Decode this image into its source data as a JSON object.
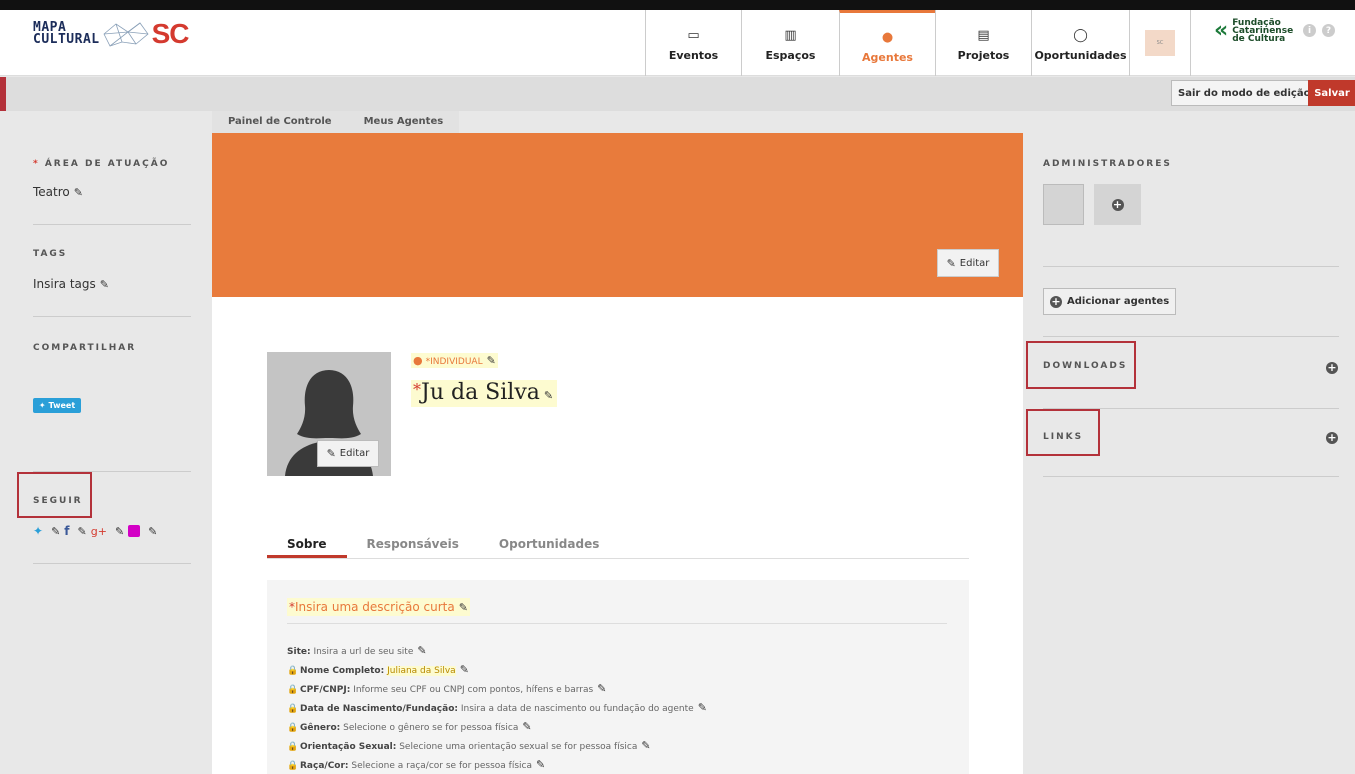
{
  "header": {
    "logo_text": "MAPA\nCULTURAL",
    "logo_sc": "SC",
    "nav": [
      {
        "label": "Eventos",
        "icon": "calendar-icon"
      },
      {
        "label": "Espaços",
        "icon": "building-icon"
      },
      {
        "label": "Agentes",
        "icon": "person-icon"
      },
      {
        "label": "Projetos",
        "icon": "document-icon"
      },
      {
        "label": "Oportunidades",
        "icon": "lightbulb-icon"
      }
    ],
    "partner_logo_text": "Fundação\nCatarinense\nde Cultura"
  },
  "editbar": {
    "exit_label": "Sair do modo de edição",
    "save_label": "Salvar"
  },
  "breadcrumb": [
    "Painel de Controle",
    "Meus Agentes"
  ],
  "left": {
    "area_title": "ÁREA DE ATUAÇÃO",
    "area_value": "Teatro",
    "tags_title": "TAGS",
    "tags_value": "Insira tags",
    "share_title": "COMPARTILHAR",
    "tweet_label": "Tweet",
    "follow_title": "SEGUIR"
  },
  "banner": {
    "edit_label": "Editar"
  },
  "profile": {
    "avatar_edit_label": "Editar",
    "type_label": "*INDIVIDUAL",
    "name": "Ju da Silva"
  },
  "tabs": [
    "Sobre",
    "Responsáveis",
    "Oportunidades"
  ],
  "about": {
    "short_desc": "Insira uma descrição curta",
    "fields": [
      {
        "label": "Site:",
        "value": "Insira a url de seu site",
        "locked": false,
        "filled": false
      },
      {
        "label": "Nome Completo:",
        "value": "Juliana da Silva",
        "locked": true,
        "filled": true
      },
      {
        "label": "CPF/CNPJ:",
        "value": "Informe seu CPF ou CNPJ com pontos, hífens e barras",
        "locked": true,
        "filled": false
      },
      {
        "label": "Data de Nascimento/Fundação:",
        "value": "Insira a data de nascimento ou fundação do agente",
        "locked": true,
        "filled": false
      },
      {
        "label": "Gênero:",
        "value": "Selecione o gênero se for pessoa física",
        "locked": true,
        "filled": false
      },
      {
        "label": "Orientação Sexual:",
        "value": "Selecione uma orientação sexual se for pessoa física",
        "locked": true,
        "filled": false
      },
      {
        "label": "Raça/Cor:",
        "value": "Selecione a raça/cor se for pessoa física",
        "locked": true,
        "filled": false
      }
    ]
  },
  "right": {
    "admins_title": "ADMINISTRADORES",
    "add_agents_label": "Adicionar agentes",
    "downloads_title": "DOWNLOADS",
    "links_title": "LINKS"
  },
  "colors": {
    "accent": "#e8783b",
    "save": "#c0392b",
    "highlight_box": "#b3313a"
  }
}
